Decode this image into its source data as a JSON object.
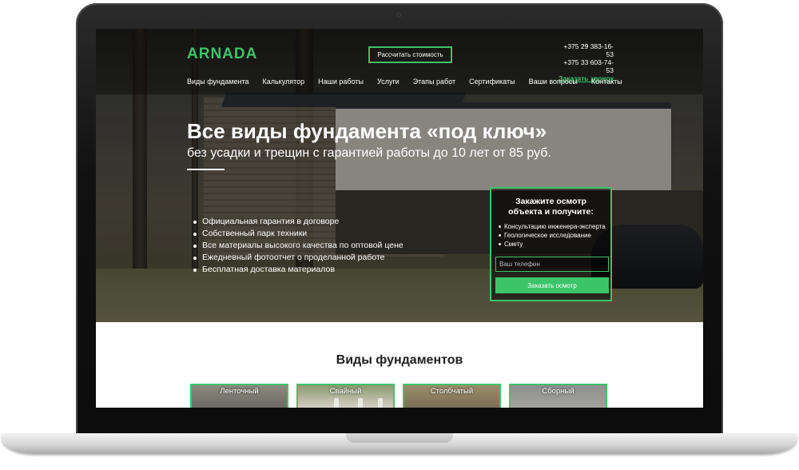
{
  "brand": {
    "logo": "ARNADA",
    "accent": "#3cc46a"
  },
  "header": {
    "calc_button": "Рассчитать стоимость",
    "phone_1": "+375 29 383-16-53",
    "phone_2": "+375 33 603-74-53",
    "callback_link": "Заказать звонок"
  },
  "nav": {
    "items": [
      "Виды фундамента",
      "Калькулятор",
      "Наши работы",
      "Услуги",
      "Этапы работ",
      "Сертификаты",
      "Ваши вопросы",
      "Контакты"
    ]
  },
  "hero": {
    "title": "Все виды фундамента «под ключ»",
    "subtitle": "без усадки и трещин с гарантией работы до 10 лет от 85 руб.",
    "bullets": [
      "Официальная гарантия в договоре",
      "Собственный парк техники",
      "Все материалы высокого качества по оптовой цене",
      "Ежедневный фотоотчет о проделанной работе",
      "Бесплатная доставка материалов"
    ]
  },
  "form": {
    "title_line_1": "Закажите осмотр",
    "title_line_2": "объекта и получите:",
    "items": [
      "Консультацию инженера-эксперта",
      "Геологическое исследование",
      "Смету"
    ],
    "phone_placeholder": "Ваш телефон",
    "submit": "Заказать осмотр"
  },
  "foundations": {
    "title": "Виды фундаментов",
    "cards": [
      "Ленточный",
      "Свайный",
      "Столбчатый",
      "Сборный"
    ]
  }
}
